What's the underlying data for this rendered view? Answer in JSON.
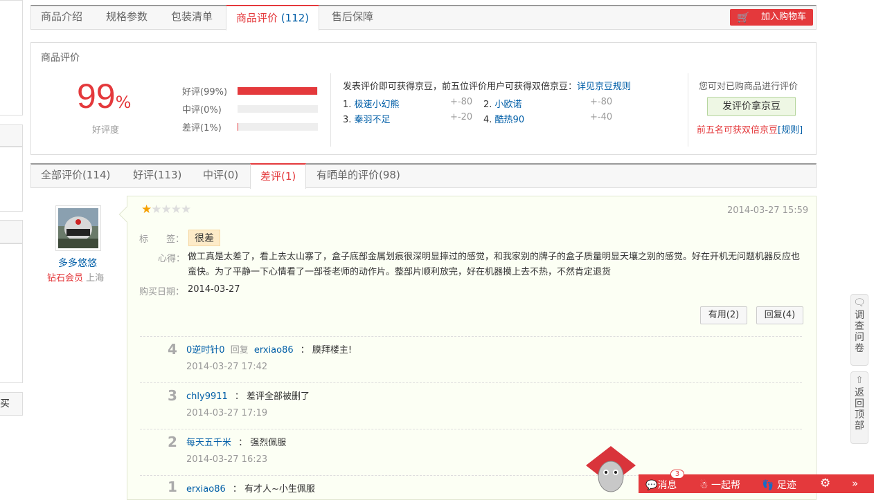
{
  "tabs": [
    {
      "label": "商品介绍"
    },
    {
      "label": "规格参数"
    },
    {
      "label": "包装清单"
    },
    {
      "label": "商品评价",
      "count": "(112)"
    },
    {
      "label": "售后保障"
    }
  ],
  "cart_button": "加入购物车",
  "summary": {
    "title": "商品评价",
    "percent": "99",
    "percent_sign": "%",
    "percent_label": "好评度",
    "ratings": [
      {
        "label": "好评(99%)",
        "fraction": 0.99
      },
      {
        "label": "中评(0%)",
        "fraction": 0
      },
      {
        "label": "差评(1%)",
        "fraction": 0.01
      }
    ],
    "notice": "发表评价即可获得京豆，前五位评价用户可获得双倍京豆：",
    "notice_link": "详见京豆规则",
    "leaders": [
      {
        "rank": "1.",
        "name": "极速小幻熊",
        "score": "+-80"
      },
      {
        "rank": "2.",
        "name": "小欧诺",
        "score": "+-80"
      },
      {
        "rank": "3.",
        "name": "秦羽不足",
        "score": "+-20"
      },
      {
        "rank": "4.",
        "name": "酷热90",
        "score": "+-40"
      }
    ],
    "can_rate": "您可对已购商品进行评价",
    "rate_button": "发评价拿京豆",
    "double_tip": "前五名可获双倍京豆",
    "rule_link": "[规则]"
  },
  "review_tabs": [
    {
      "label": "全部评价(114)"
    },
    {
      "label": "好评(113)"
    },
    {
      "label": "中评(0)"
    },
    {
      "label": "差评(1)"
    },
    {
      "label": "有晒单的评价(98)"
    }
  ],
  "review": {
    "user": "多多悠悠",
    "level": "钻石会员",
    "location": "上海",
    "stars": 1,
    "date": "2014-03-27 15:59",
    "tag_label": "标　　签：",
    "tag": "很差",
    "content_label": "心得：",
    "content": "做工真是太差了，看上去太山寨了，盒子底部金属划痕很深明显摔过的感觉，和我家别的牌子的盒子质量明显天壤之别的感觉。好在开机无问题机器反应也蛮快。为了平静一下心情看了一部苍老师的动作片。整部片顺利放完，好在机器摸上去不热，不然肯定退货",
    "buy_label": "购买日期：",
    "buy_date": "2014-03-27",
    "useful": "有用(2)",
    "reply_btn": "回复(4)"
  },
  "replies": [
    {
      "num": "4",
      "user": "0逆时针0",
      "mid": "回复",
      "target": "erxiao86",
      "text": "：  膜拜楼主!",
      "time": "2014-03-27 17:42"
    },
    {
      "num": "3",
      "user": "chly9911",
      "mid": "",
      "target": "",
      "text": "：  差评全部被删了",
      "time": "2014-03-27 17:19"
    },
    {
      "num": "2",
      "user": "每天五千米",
      "mid": "",
      "target": "",
      "text": "：  强烈佩服",
      "time": "2014-03-27 16:23"
    },
    {
      "num": "1",
      "user": "erxiao86",
      "mid": "",
      "target": "",
      "text": "：  有才人~小生佩服",
      "time": ""
    }
  ],
  "side": {
    "survey": "调查问卷",
    "top": "返回顶部",
    "left_text": "买"
  },
  "bottom_bar": {
    "msg": "消息",
    "msg_count": "3",
    "help": "一起帮",
    "trace": "足迹",
    "more": "»"
  },
  "colors": {
    "accent": "#e4393c",
    "link": "#005ea7"
  }
}
